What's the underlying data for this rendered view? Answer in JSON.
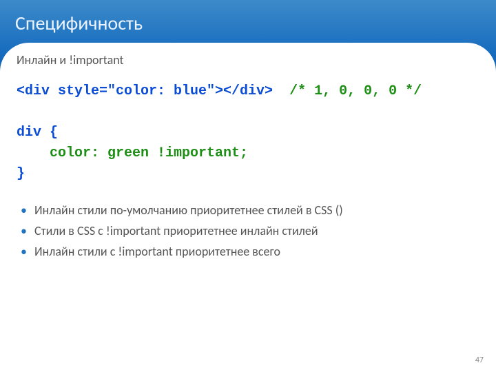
{
  "title": "Специфичность",
  "subtitle": "Инлайн и !important",
  "code": {
    "line1_html": "<div style=\"color: blue\"></div>",
    "line1_comment": "/* 1, 0, 0, 0 */",
    "line3": "div {",
    "line4": "    color: green !important;",
    "line5": "}"
  },
  "bullets": [
    "Инлайн стили по-умолчанию приоритетнее стилей в CSS ()",
    "Стили в CSS с !important приоритетнее инлайн стилей",
    "Инлайн стили с !important приоритетнее всего"
  ],
  "page_number": "47"
}
